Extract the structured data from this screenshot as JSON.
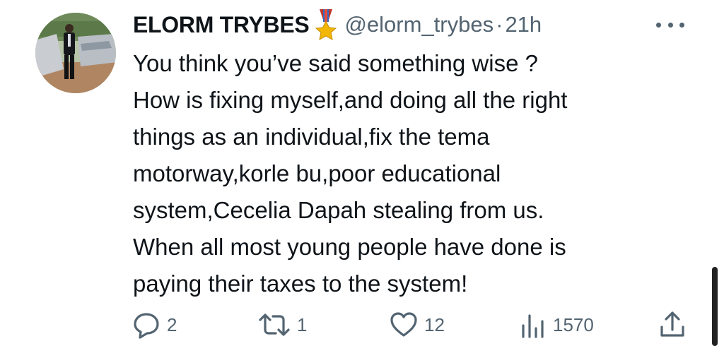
{
  "user": {
    "display_name": "ELORM TRYBES",
    "handle": "@elorm_trybes",
    "separator": "·",
    "time": "21h",
    "badge_icon": "military-medal-icon"
  },
  "tweet": {
    "lines": [
      "You think you’ve said something wise ?",
      "How is fixing myself,and doing all the right",
      "things as an individual,fix the tema",
      "motorway,korle bu,poor educational",
      "system,Cecelia Dapah stealing from us.",
      "When all most young people have done is",
      "paying their taxes to the system!"
    ]
  },
  "actions": {
    "replies": "2",
    "retweets": "1",
    "likes": "12",
    "views": "1570"
  },
  "colors": {
    "text": "#0f1419",
    "muted": "#536471"
  }
}
